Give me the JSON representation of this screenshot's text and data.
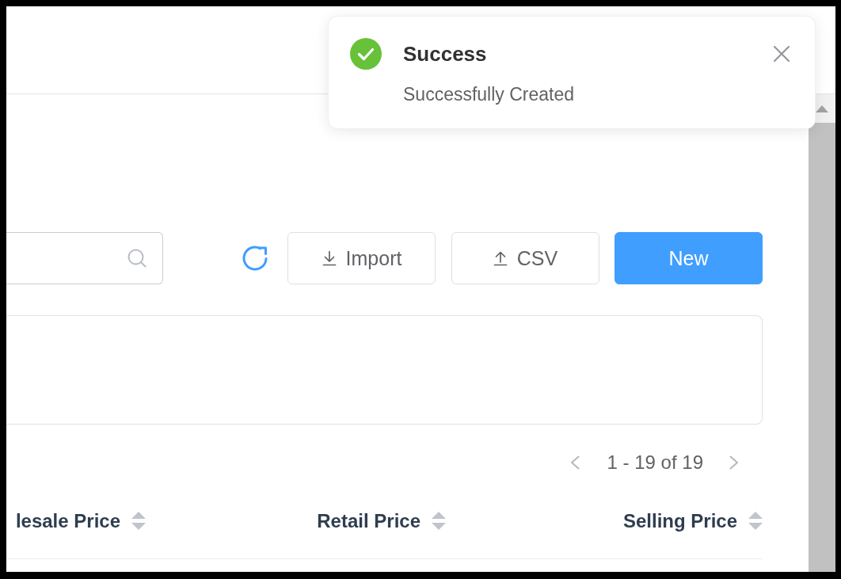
{
  "toast": {
    "kind": "success",
    "title": "Success",
    "message": "Successfully Created"
  },
  "toolbar": {
    "buttons": [
      {
        "label": "Import",
        "kind": "download"
      },
      {
        "label": "CSV",
        "kind": "upload"
      },
      {
        "label": "New",
        "kind": "primary"
      }
    ]
  },
  "pagination": {
    "previous": {
      "disabled": true
    },
    "range": "1 - 19 of 19",
    "next": {
      "disabled": true
    }
  },
  "table": {
    "columns": [
      "lesale Price",
      "Retail Price",
      "Selling Price"
    ]
  }
}
